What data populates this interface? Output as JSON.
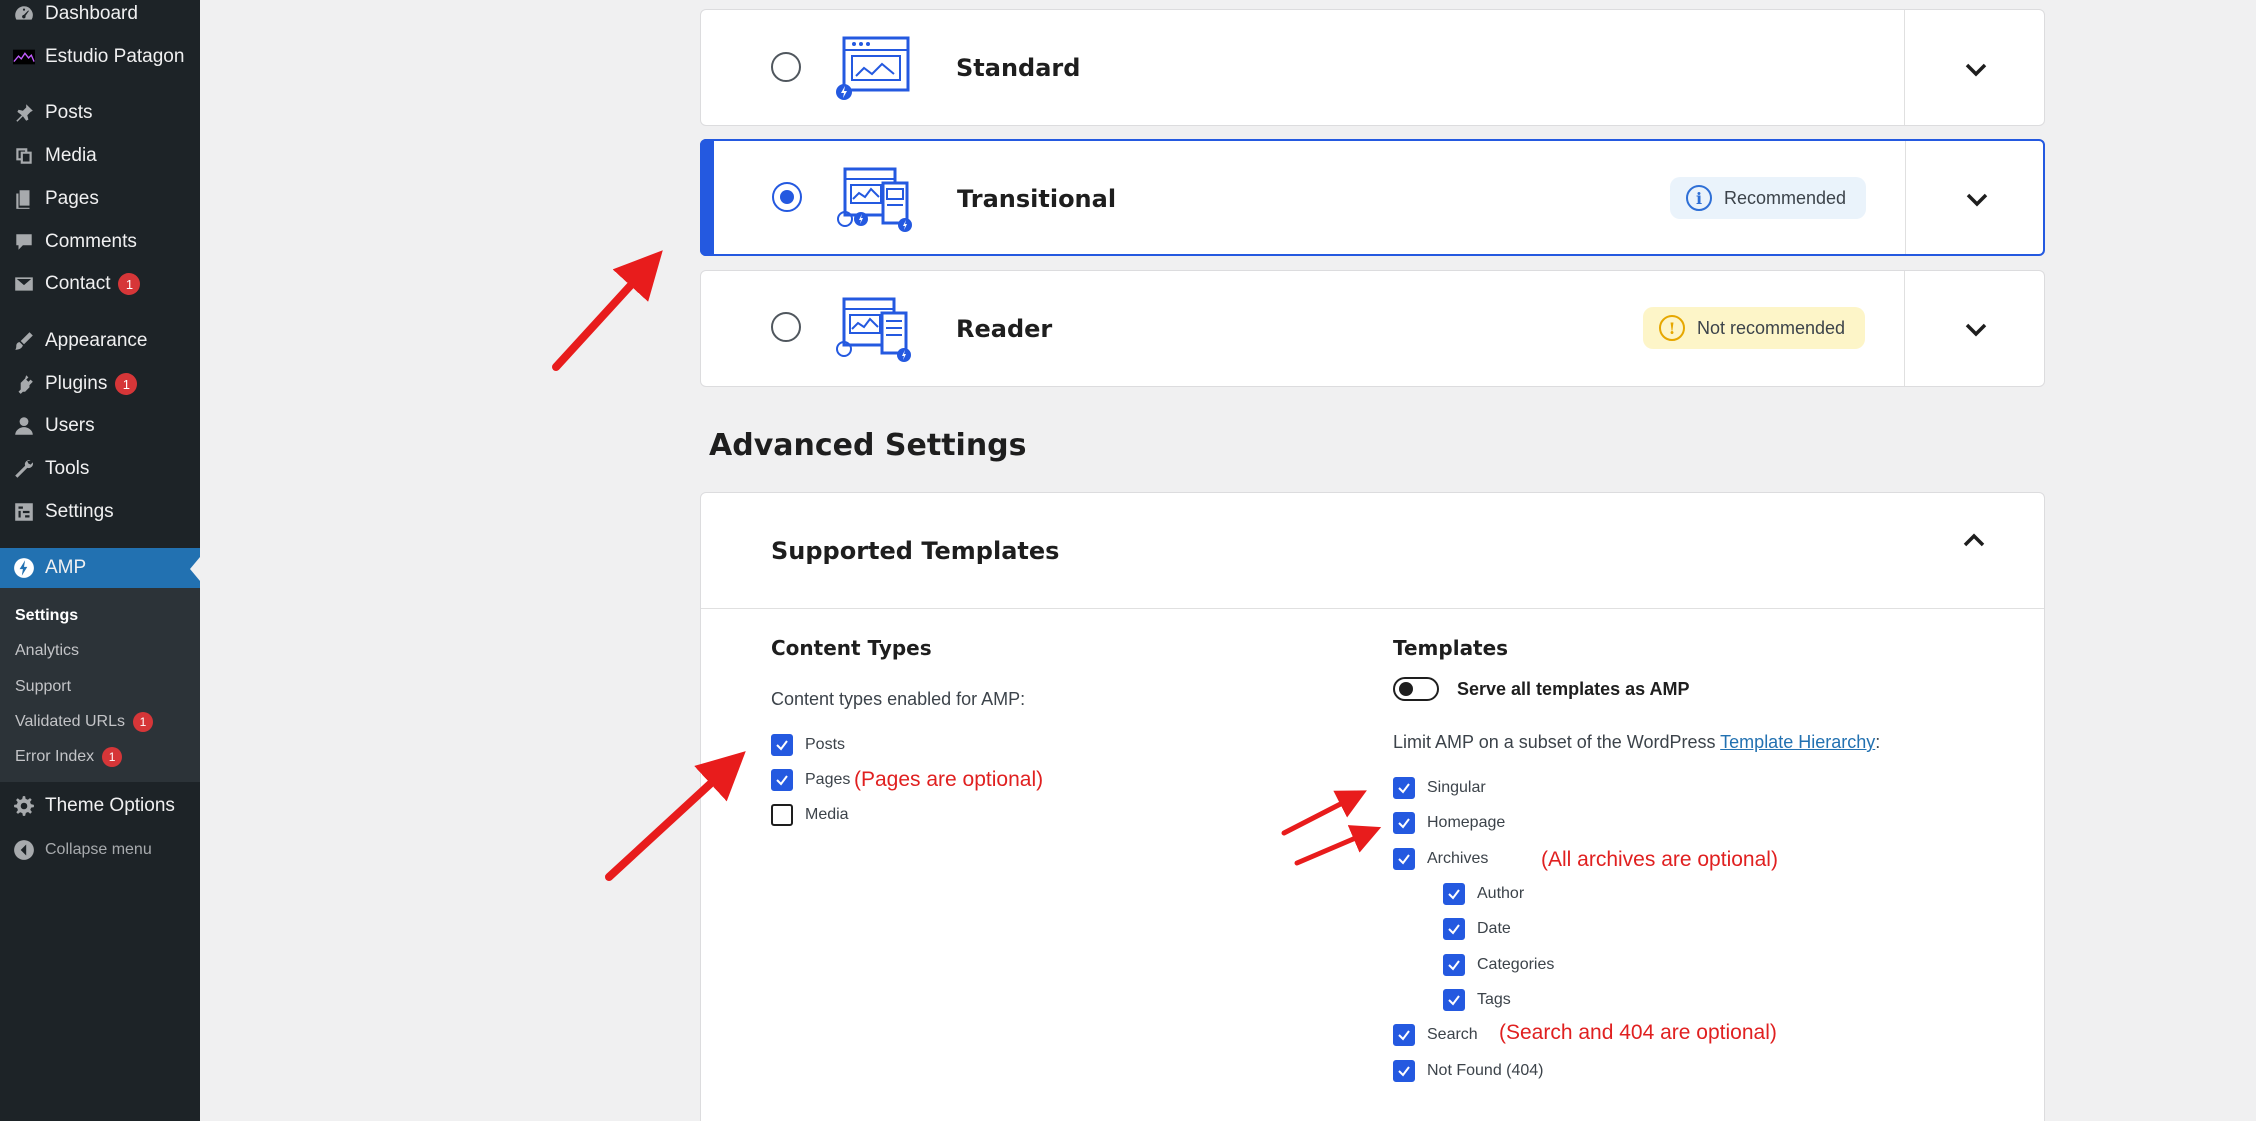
{
  "sidebar": {
    "items": [
      {
        "label": "Dashboard",
        "icon": "dashboard-icon"
      },
      {
        "label": "Estudio Patagon",
        "icon": "site-logo-icon"
      },
      {
        "label": "Posts",
        "icon": "pin-icon"
      },
      {
        "label": "Media",
        "icon": "media-icon"
      },
      {
        "label": "Pages",
        "icon": "pages-icon"
      },
      {
        "label": "Comments",
        "icon": "comment-icon"
      },
      {
        "label": "Contact",
        "icon": "mail-icon",
        "badge": "1"
      },
      {
        "label": "Appearance",
        "icon": "brush-icon"
      },
      {
        "label": "Plugins",
        "icon": "plugin-icon",
        "badge": "1"
      },
      {
        "label": "Users",
        "icon": "user-icon"
      },
      {
        "label": "Tools",
        "icon": "wrench-icon"
      },
      {
        "label": "Settings",
        "icon": "settings-icon"
      },
      {
        "label": "AMP",
        "icon": "amp-bolt-icon"
      },
      {
        "label": "Theme Options",
        "icon": "gear-icon"
      }
    ],
    "submenu": [
      {
        "label": "Settings"
      },
      {
        "label": "Analytics"
      },
      {
        "label": "Support"
      },
      {
        "label": "Validated URLs",
        "badge": "1"
      },
      {
        "label": "Error Index",
        "badge": "1"
      }
    ],
    "collapse_label": "Collapse menu"
  },
  "modes": [
    {
      "title": "Standard",
      "selected": false
    },
    {
      "title": "Transitional",
      "selected": true,
      "pill": "Recommended"
    },
    {
      "title": "Reader",
      "selected": false,
      "pill": "Not recommended"
    }
  ],
  "advanced": {
    "title": "Advanced Settings",
    "panel_title": "Supported Templates",
    "content_types": {
      "title": "Content Types",
      "desc": "Content types enabled for AMP:",
      "items": [
        {
          "label": "Posts",
          "checked": true
        },
        {
          "label": "Pages",
          "checked": true
        },
        {
          "label": "Media",
          "checked": false
        }
      ]
    },
    "templates": {
      "title": "Templates",
      "toggle_label": "Serve all templates as AMP",
      "desc_prefix": "Limit AMP on a subset of the WordPress ",
      "desc_link": "Template Hierarchy",
      "desc_suffix": ":",
      "items": [
        {
          "label": "Singular",
          "checked": true
        },
        {
          "label": "Homepage",
          "checked": true
        },
        {
          "label": "Archives",
          "checked": true
        },
        {
          "label": "Author",
          "checked": true
        },
        {
          "label": "Date",
          "checked": true
        },
        {
          "label": "Categories",
          "checked": true
        },
        {
          "label": "Tags",
          "checked": true
        },
        {
          "label": "Search",
          "checked": true
        },
        {
          "label": "Not Found (404)",
          "checked": true
        }
      ]
    }
  },
  "annotations": {
    "pages_note": "(Pages are optional)",
    "archives_note": "(All archives are optional)",
    "search_note": "(Search and 404 are optional)"
  },
  "colors": {
    "sidebar_bg": "#1d2327",
    "wp_blue": "#2271b1",
    "amp_blue": "#2459e0",
    "annotation_red": "#e02020"
  }
}
